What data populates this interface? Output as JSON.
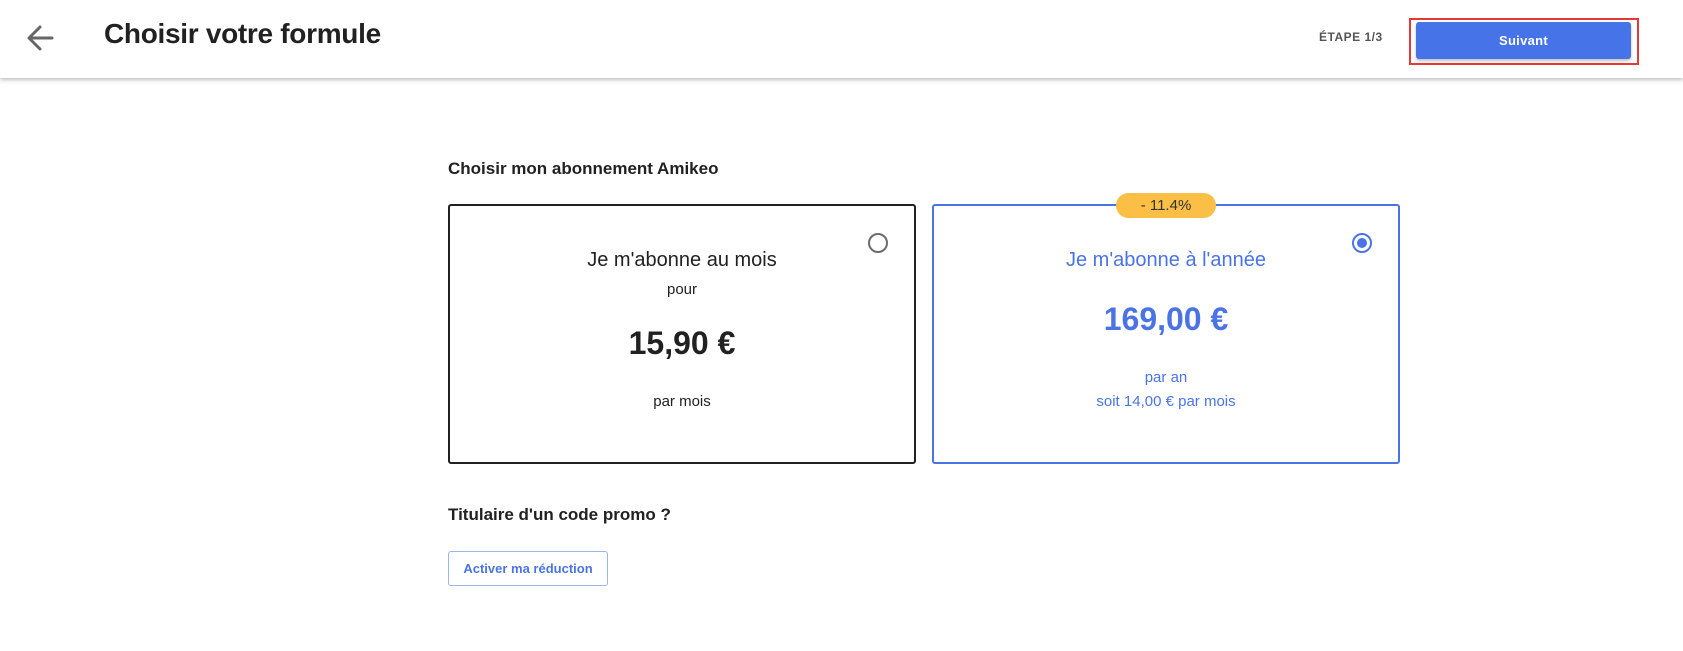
{
  "header": {
    "back_icon": "arrow-left-icon",
    "title": "Choisir votre formule",
    "step": "ÉTAPE 1/3",
    "next_label": "Suivant"
  },
  "subscription": {
    "title": "Choisir mon abonnement Amikeo",
    "monthly": {
      "name": "Je m'abonne au mois",
      "sub": "pour",
      "price": "15,90 €",
      "period": "par mois",
      "selected": false
    },
    "yearly": {
      "badge": "- 11.4%",
      "name": "Je m'abonne à l'année",
      "price": "169,00 €",
      "period": "par an",
      "equivalent": "soit 14,00 € par mois",
      "selected": true
    }
  },
  "promo": {
    "title": "Titulaire d'un code promo ?",
    "button_label": "Activer ma réduction"
  },
  "colors": {
    "accent": "#4a74e6",
    "button": "#4673e8",
    "badge": "#fbbf45",
    "highlight": "#e53935",
    "text": "#212121"
  }
}
